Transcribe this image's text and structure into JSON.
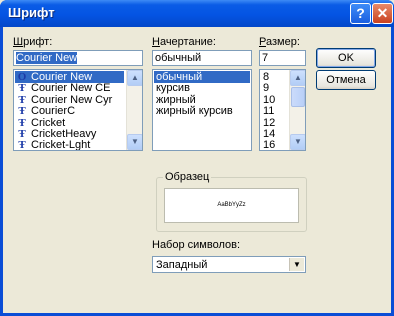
{
  "window": {
    "title": "Шрифт"
  },
  "titlebar_buttons": {
    "help": "?",
    "close": "✕"
  },
  "font": {
    "label_before": "",
    "label_key": "Ш",
    "label_after": "рифт:",
    "value": "Courier New",
    "items": [
      {
        "name": "Courier New",
        "icon": "opentype-icon",
        "selected": true
      },
      {
        "name": "Courier New CE",
        "icon": "truetype-icon",
        "selected": false
      },
      {
        "name": "Courier New Cyr",
        "icon": "truetype-icon",
        "selected": false
      },
      {
        "name": "CourierC",
        "icon": "truetype-icon",
        "selected": false
      },
      {
        "name": "Cricket",
        "icon": "truetype-icon",
        "selected": false
      },
      {
        "name": "CricketHeavy",
        "icon": "truetype-icon",
        "selected": false
      },
      {
        "name": "Cricket-Lght",
        "icon": "truetype-icon",
        "selected": false
      }
    ]
  },
  "style": {
    "label_before": "",
    "label_key": "Н",
    "label_after": "ачертание:",
    "value": "обычный",
    "items": [
      {
        "name": "обычный",
        "selected": true
      },
      {
        "name": "курсив",
        "selected": false
      },
      {
        "name": "жирный",
        "selected": false
      },
      {
        "name": "жирный курсив",
        "selected": false
      }
    ]
  },
  "size": {
    "label_before": "",
    "label_key": "Р",
    "label_after": "азмер:",
    "value": "7",
    "items": [
      "8",
      "9",
      "10",
      "11",
      "12",
      "14",
      "16"
    ]
  },
  "buttons": {
    "ok": "OK",
    "cancel": "Отмена"
  },
  "sample": {
    "title": "Образец",
    "text": "AaBbYyZz"
  },
  "charset": {
    "label": "Набор символов:",
    "value": "Западный"
  },
  "icons": {
    "scroll_up": "▲",
    "scroll_down": "▼",
    "dropdown": "▼",
    "tt_glyph": "Ŧ",
    "ot_glyph": "O"
  }
}
